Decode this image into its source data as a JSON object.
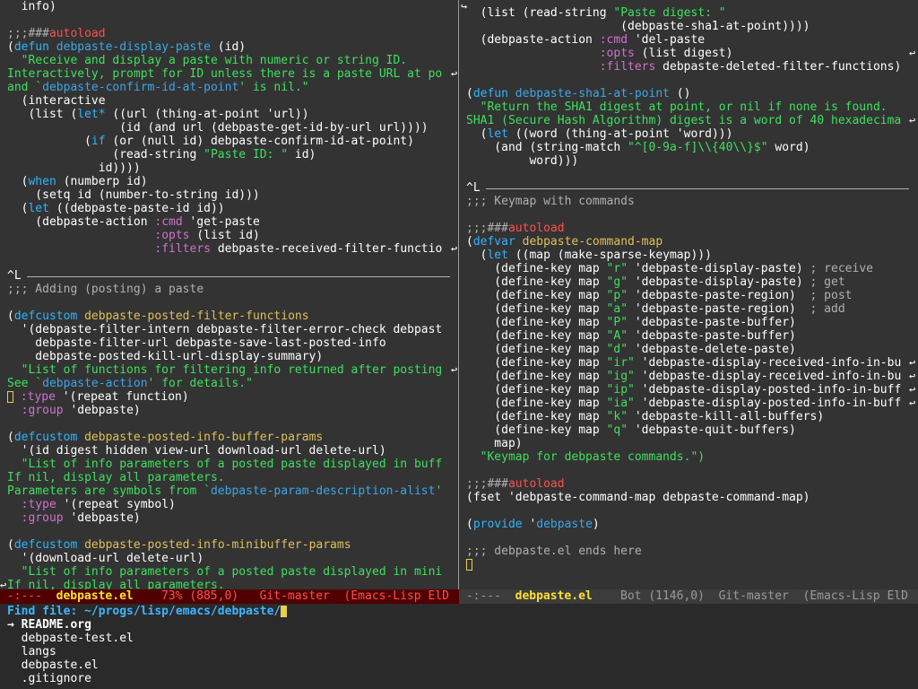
{
  "left_pane": {
    "lines": [
      [
        [
          "  info)",
          ""
        ]
      ],
      [
        [
          "",
          ""
        ]
      ],
      [
        [
          ";;;###",
          "comment"
        ],
        [
          "autoload",
          "cookie"
        ]
      ],
      [
        [
          "(",
          ""
        ],
        [
          "defun",
          "kw"
        ],
        [
          " ",
          ""
        ],
        [
          "debpaste-display-paste",
          "fn"
        ],
        [
          " (id)",
          ""
        ]
      ],
      [
        [
          "  \"Receive and display a paste with numeric or string ID.",
          "str"
        ]
      ],
      [
        [
          "Interactively, prompt for ID unless there is a paste URL at po",
          "str"
        ]
      ],
      [
        [
          "and `",
          "str"
        ],
        [
          "debpaste-confirm-id-at-point",
          "fn"
        ],
        [
          "' is nil.\"",
          "str"
        ]
      ],
      [
        [
          "  (interactive",
          ""
        ]
      ],
      [
        [
          "   (list (",
          ""
        ],
        [
          "let*",
          "kw"
        ],
        [
          " ((url (thing-at-point 'url))",
          ""
        ]
      ],
      [
        [
          "                (id (and url (debpaste-get-id-by-url url))))",
          ""
        ]
      ],
      [
        [
          "           (",
          ""
        ],
        [
          "if",
          "kw"
        ],
        [
          " (or (null id) debpaste-confirm-id-at-point)",
          ""
        ]
      ],
      [
        [
          "               (read-string ",
          ""
        ],
        [
          "\"Paste ID: \"",
          "str"
        ],
        [
          " id)",
          ""
        ]
      ],
      [
        [
          "             id))))",
          ""
        ]
      ],
      [
        [
          "  (",
          ""
        ],
        [
          "when",
          "kw"
        ],
        [
          " (numberp id)",
          ""
        ]
      ],
      [
        [
          "    (setq id (number-to-string id)))",
          ""
        ]
      ],
      [
        [
          "  (",
          ""
        ],
        [
          "let",
          "kw"
        ],
        [
          " ((debpaste-paste-id id))",
          ""
        ]
      ],
      [
        [
          "    (debpaste-action ",
          ""
        ],
        [
          ":cmd",
          "const"
        ],
        [
          " 'get-paste",
          ""
        ]
      ],
      [
        [
          "                     ",
          ""
        ],
        [
          ":opts",
          "const"
        ],
        [
          " (list id)",
          ""
        ]
      ],
      [
        [
          "                     ",
          ""
        ],
        [
          ":filters",
          "const"
        ],
        [
          " debpaste-received-filter-functio",
          ""
        ]
      ],
      [
        [
          "",
          ""
        ]
      ],
      [
        [
          "^L",
          "ff"
        ]
      ],
      [
        [
          ";;; Adding (posting) a paste",
          "comment"
        ]
      ],
      [
        [
          "",
          ""
        ]
      ],
      [
        [
          "(",
          ""
        ],
        [
          "defcustom",
          "kw"
        ],
        [
          " ",
          ""
        ],
        [
          "debpaste-posted-filter-functions",
          "var"
        ]
      ],
      [
        [
          "  '(debpaste-filter-intern debpaste-filter-error-check debpast",
          ""
        ]
      ],
      [
        [
          "    debpaste-filter-url debpaste-save-last-posted-info",
          ""
        ]
      ],
      [
        [
          "    debpaste-posted-kill-url-display-summary)",
          ""
        ]
      ],
      [
        [
          "  \"List of functions for filtering info returned after posting",
          "str"
        ]
      ],
      [
        [
          "See `",
          "str"
        ],
        [
          "debpaste-action",
          "fn"
        ],
        [
          "' for details.\"",
          "str"
        ]
      ],
      [
        [
          "CURSOR",
          ""
        ],
        [
          " ",
          ""
        ],
        [
          ":type",
          "const"
        ],
        [
          " '(repeat function)",
          ""
        ]
      ],
      [
        [
          "  ",
          ""
        ],
        [
          ":group",
          "const"
        ],
        [
          " 'debpaste)",
          ""
        ]
      ],
      [
        [
          "",
          ""
        ]
      ],
      [
        [
          "(",
          ""
        ],
        [
          "defcustom",
          "kw"
        ],
        [
          " ",
          ""
        ],
        [
          "debpaste-posted-info-buffer-params",
          "var"
        ]
      ],
      [
        [
          "  '(id digest hidden view-url download-url delete-url)",
          ""
        ]
      ],
      [
        [
          "  \"List of info parameters of a posted paste displayed in buff",
          "str"
        ]
      ],
      [
        [
          "If nil, display all parameters.",
          "str"
        ]
      ],
      [
        [
          "Parameters are symbols from `",
          "str"
        ],
        [
          "debpaste-param-description-alist",
          "fn"
        ],
        [
          "'",
          "str"
        ]
      ],
      [
        [
          "  ",
          ""
        ],
        [
          ":type",
          "const"
        ],
        [
          " '(repeat symbol)",
          ""
        ]
      ],
      [
        [
          "  ",
          ""
        ],
        [
          ":group",
          "const"
        ],
        [
          " 'debpaste)",
          ""
        ]
      ],
      [
        [
          "",
          ""
        ]
      ],
      [
        [
          "(",
          ""
        ],
        [
          "defcustom",
          "kw"
        ],
        [
          " ",
          ""
        ],
        [
          "debpaste-posted-info-minibuffer-params",
          "var"
        ]
      ],
      [
        [
          "  '(download-url delete-url)",
          ""
        ]
      ],
      [
        [
          "  \"List of info parameters of a posted paste displayed in mini",
          "str"
        ]
      ],
      [
        [
          "If nil, display all parameters.",
          "str"
        ]
      ]
    ]
  },
  "right_pane": {
    "lines": [
      [
        [
          "  (list (read-string ",
          ""
        ],
        [
          "\"Paste digest: \"",
          "str"
        ]
      ],
      [
        [
          "                      (debpaste-sha1-at-point))))",
          ""
        ]
      ],
      [
        [
          "  (debpaste-action ",
          ""
        ],
        [
          ":cmd",
          "const"
        ],
        [
          " 'del-paste",
          ""
        ]
      ],
      [
        [
          "                   ",
          ""
        ],
        [
          ":opts",
          "const"
        ],
        [
          " (list digest)",
          ""
        ]
      ],
      [
        [
          "                   ",
          ""
        ],
        [
          ":filters",
          "const"
        ],
        [
          " debpaste-deleted-filter-functions)",
          ""
        ]
      ],
      [
        [
          "",
          ""
        ]
      ],
      [
        [
          "(",
          ""
        ],
        [
          "defun",
          "kw"
        ],
        [
          " ",
          ""
        ],
        [
          "debpaste-sha1-at-point",
          "fn"
        ],
        [
          " ()",
          ""
        ]
      ],
      [
        [
          "  \"Return the SHA1 digest at point, or nil if none is found.",
          "str"
        ]
      ],
      [
        [
          "SHA1 (Secure Hash Algorithm) digest is a word of 40 hexadecima",
          "str"
        ]
      ],
      [
        [
          "  (",
          ""
        ],
        [
          "let",
          "kw"
        ],
        [
          " ((word (thing-at-point 'word)))",
          ""
        ]
      ],
      [
        [
          "    (and (string-match ",
          ""
        ],
        [
          "\"^[0-9a-f]\\\\{40\\\\}$\"",
          "str"
        ],
        [
          " word)",
          ""
        ]
      ],
      [
        [
          "         word)))",
          ""
        ]
      ],
      [
        [
          "",
          ""
        ]
      ],
      [
        [
          "^L",
          "ff"
        ]
      ],
      [
        [
          ";;; Keymap with commands",
          "comment"
        ]
      ],
      [
        [
          "",
          ""
        ]
      ],
      [
        [
          ";;;###",
          "comment"
        ],
        [
          "autoload",
          "cookie"
        ]
      ],
      [
        [
          "(",
          ""
        ],
        [
          "defvar",
          "kw"
        ],
        [
          " ",
          ""
        ],
        [
          "debpaste-command-map",
          "var"
        ]
      ],
      [
        [
          "  (",
          ""
        ],
        [
          "let",
          "kw"
        ],
        [
          " ((map (make-sparse-keymap)))",
          ""
        ]
      ],
      [
        [
          "    (define-key map ",
          ""
        ],
        [
          "\"r\"",
          "str"
        ],
        [
          " 'debpaste-display-paste) ",
          ""
        ],
        [
          "; receive",
          "comment"
        ]
      ],
      [
        [
          "    (define-key map ",
          ""
        ],
        [
          "\"g\"",
          "str"
        ],
        [
          " 'debpaste-display-paste) ",
          ""
        ],
        [
          "; get",
          "comment"
        ]
      ],
      [
        [
          "    (define-key map ",
          ""
        ],
        [
          "\"p\"",
          "str"
        ],
        [
          " 'debpaste-paste-region)  ",
          ""
        ],
        [
          "; post",
          "comment"
        ]
      ],
      [
        [
          "    (define-key map ",
          ""
        ],
        [
          "\"a\"",
          "str"
        ],
        [
          " 'debpaste-paste-region)  ",
          ""
        ],
        [
          "; add",
          "comment"
        ]
      ],
      [
        [
          "    (define-key map ",
          ""
        ],
        [
          "\"P\"",
          "str"
        ],
        [
          " 'debpaste-paste-buffer)",
          ""
        ]
      ],
      [
        [
          "    (define-key map ",
          ""
        ],
        [
          "\"A\"",
          "str"
        ],
        [
          " 'debpaste-paste-buffer)",
          ""
        ]
      ],
      [
        [
          "    (define-key map ",
          ""
        ],
        [
          "\"d\"",
          "str"
        ],
        [
          " 'debpaste-delete-paste)",
          ""
        ]
      ],
      [
        [
          "    (define-key map ",
          ""
        ],
        [
          "\"ir\"",
          "str"
        ],
        [
          " 'debpaste-display-received-info-in-bu",
          ""
        ]
      ],
      [
        [
          "    (define-key map ",
          ""
        ],
        [
          "\"ig\"",
          "str"
        ],
        [
          " 'debpaste-display-received-info-in-bu",
          ""
        ]
      ],
      [
        [
          "    (define-key map ",
          ""
        ],
        [
          "\"ip\"",
          "str"
        ],
        [
          " 'debpaste-display-posted-info-in-buff",
          ""
        ]
      ],
      [
        [
          "    (define-key map ",
          ""
        ],
        [
          "\"ia\"",
          "str"
        ],
        [
          " 'debpaste-display-posted-info-in-buff",
          ""
        ]
      ],
      [
        [
          "    (define-key map ",
          ""
        ],
        [
          "\"k\"",
          "str"
        ],
        [
          " 'debpaste-kill-all-buffers)",
          ""
        ]
      ],
      [
        [
          "    (define-key map ",
          ""
        ],
        [
          "\"q\"",
          "str"
        ],
        [
          " 'debpaste-quit-buffers)",
          ""
        ]
      ],
      [
        [
          "    map)",
          ""
        ]
      ],
      [
        [
          "  \"Keymap for debpaste commands.\")",
          "str"
        ]
      ],
      [
        [
          "",
          ""
        ]
      ],
      [
        [
          ";;;###",
          "comment"
        ],
        [
          "autoload",
          "cookie"
        ]
      ],
      [
        [
          "(fset 'debpaste-command-map debpaste-command-map)",
          ""
        ]
      ],
      [
        [
          "",
          ""
        ]
      ],
      [
        [
          "(",
          ""
        ],
        [
          "provide",
          "kw"
        ],
        [
          " '",
          ""
        ],
        [
          "debpaste",
          "fn"
        ],
        [
          ")",
          ""
        ]
      ],
      [
        [
          "",
          ""
        ]
      ],
      [
        [
          ";;; debpaste.el ends here",
          "comment"
        ]
      ],
      [
        [
          "CURSOR",
          ""
        ]
      ]
    ]
  },
  "mode_line_left": {
    "status": " -:---  ",
    "buffer": "debpaste.el",
    "rest": "    73% (885,0)   Git-master  (Emacs-Lisp ElD"
  },
  "mode_line_right": {
    "status": " -:---  ",
    "buffer": "debpaste.el",
    "rest": "    Bot (1146,0)  Git-master  (Emacs-Lisp ElD"
  },
  "minibuffer": {
    "prompt": "Find file: ",
    "path": "~/progs/lisp/emacs/debpaste/",
    "selection_marker": "→ ",
    "completions": [
      "README.org",
      "debpaste-test.el",
      "langs",
      "debpaste.el",
      ".gitignore"
    ]
  },
  "colors": {
    "background": "#333333",
    "active_modeline": "#500000",
    "keyword": "#2fb5ff",
    "string": "#3ee05e",
    "variable": "#e0c05a",
    "constant": "#d071d0",
    "comment": "#b0b0b0",
    "cursor": "#e8d04c"
  }
}
